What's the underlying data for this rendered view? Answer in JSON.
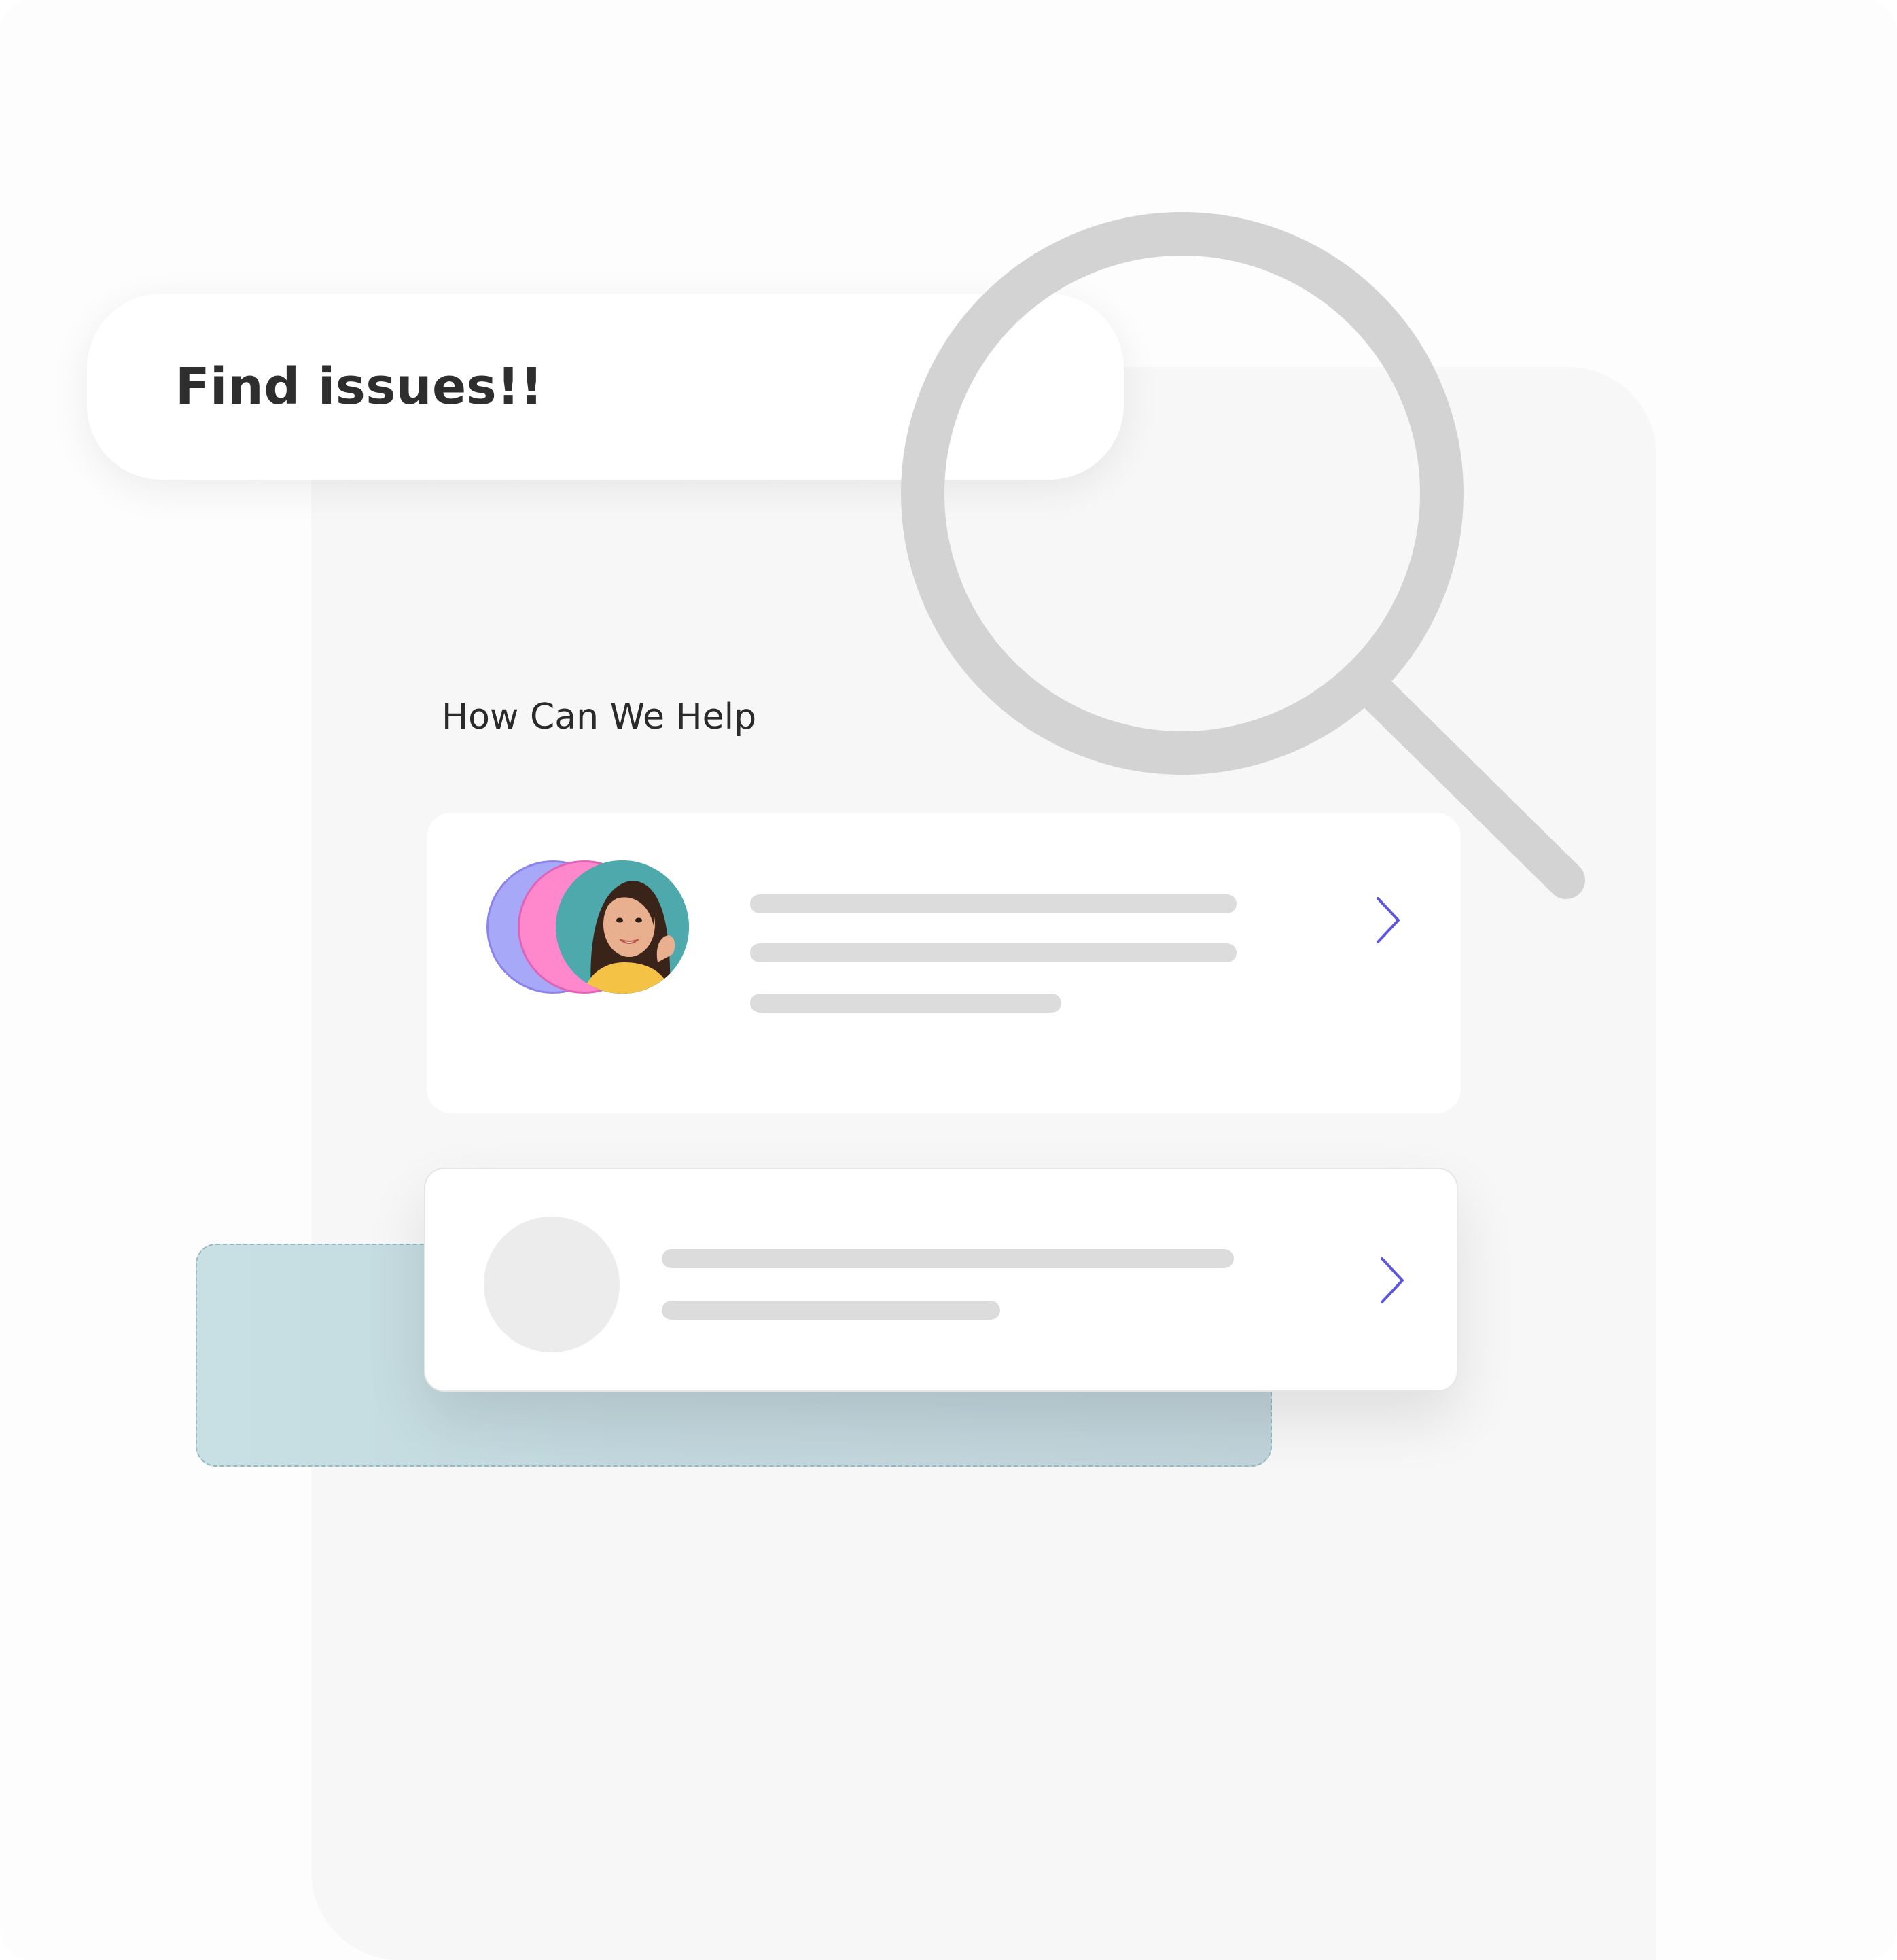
{
  "search": {
    "text": "Find issues!!"
  },
  "section": {
    "heading": "How Can We Help"
  },
  "cards": [
    {
      "avatar": "user-photo-avatar-stack",
      "action_icon": "chevron-right-icon"
    },
    {
      "avatar": "placeholder-avatar",
      "action_icon": "chevron-right-icon"
    }
  ],
  "colors": {
    "accent": "#5b57e0",
    "magnifier": "#d3d3d3",
    "skeleton": "#dcdcdc",
    "panel": "#f7f7f7",
    "ghost_card": "#c4dadf"
  }
}
